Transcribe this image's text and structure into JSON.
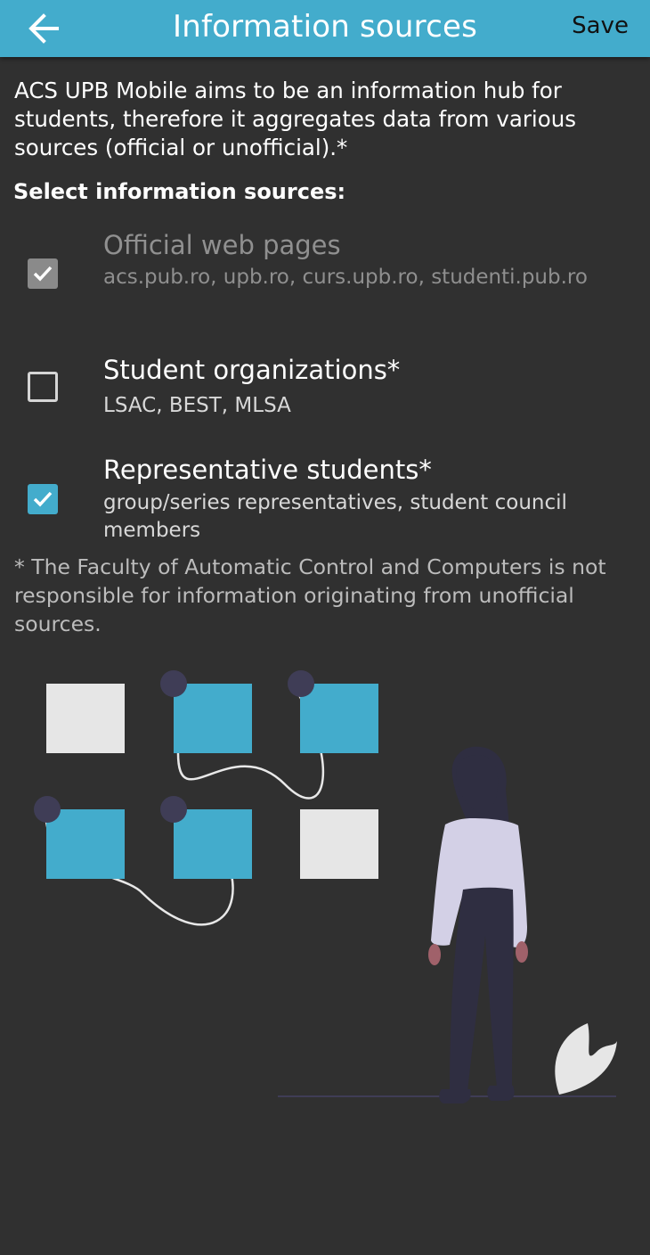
{
  "appbar": {
    "back_icon": "arrow-back-icon",
    "title": "Information sources",
    "save_label": "Save",
    "background": "#43accc"
  },
  "intro_text": "ACS UPB Mobile aims to be an information hub for students, therefore it aggregates data from various sources (official or unofficial).*",
  "section_heading": "Select information sources:",
  "sources": [
    {
      "title": "Official web pages",
      "subtitle": "acs.pub.ro, upb.ro, curs.upb.ro, studenti.pub.ro",
      "checked": true,
      "enabled": false
    },
    {
      "title": "Student organizations*",
      "subtitle": "LSAC, BEST, MLSA",
      "checked": false,
      "enabled": true
    },
    {
      "title": "Representative students*",
      "subtitle": "group/series representatives, student council members",
      "checked": true,
      "enabled": true
    }
  ],
  "footnote": "* The Faculty of Automatic Control and Computers is not responsible for information originating from unofficial sources.",
  "colors": {
    "accent": "#43accc",
    "background": "#303030",
    "card_light": "#e6e6e6",
    "dot": "#3f3d56"
  }
}
